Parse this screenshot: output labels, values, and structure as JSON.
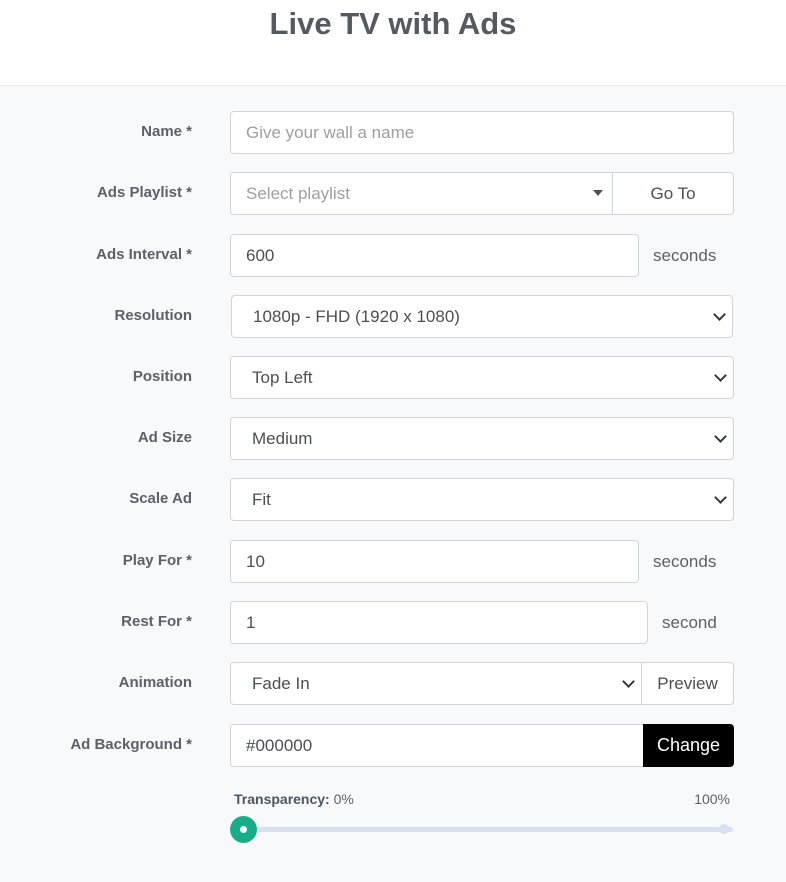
{
  "page": {
    "title": "Live TV with Ads"
  },
  "form": {
    "name": {
      "label": "Name *",
      "placeholder": "Give your wall a name",
      "value": ""
    },
    "ads_playlist": {
      "label": "Ads Playlist *",
      "placeholder": "Select playlist",
      "goto_label": "Go To"
    },
    "ads_interval": {
      "label": "Ads Interval *",
      "value": "600",
      "unit": "seconds"
    },
    "resolution": {
      "label": "Resolution",
      "value": "1080p - FHD (1920 x 1080)"
    },
    "position": {
      "label": "Position",
      "value": "Top Left"
    },
    "ad_size": {
      "label": "Ad Size",
      "value": "Medium"
    },
    "scale_ad": {
      "label": "Scale Ad",
      "value": "Fit"
    },
    "play_for": {
      "label": "Play For *",
      "value": "10",
      "unit": "seconds"
    },
    "rest_for": {
      "label": "Rest For *",
      "value": "1",
      "unit": "second"
    },
    "animation": {
      "label": "Animation",
      "value": "Fade In",
      "preview_label": "Preview"
    },
    "ad_background": {
      "label": "Ad Background *",
      "value": "#000000",
      "change_label": "Change"
    },
    "transparency": {
      "label": "Transparency:",
      "value": "0%",
      "max": "100%",
      "level_fraction": 0.0
    }
  },
  "colors": {
    "accent": "#1aab8a",
    "track": "#d8e0ef",
    "background": "#f8f9fb"
  }
}
